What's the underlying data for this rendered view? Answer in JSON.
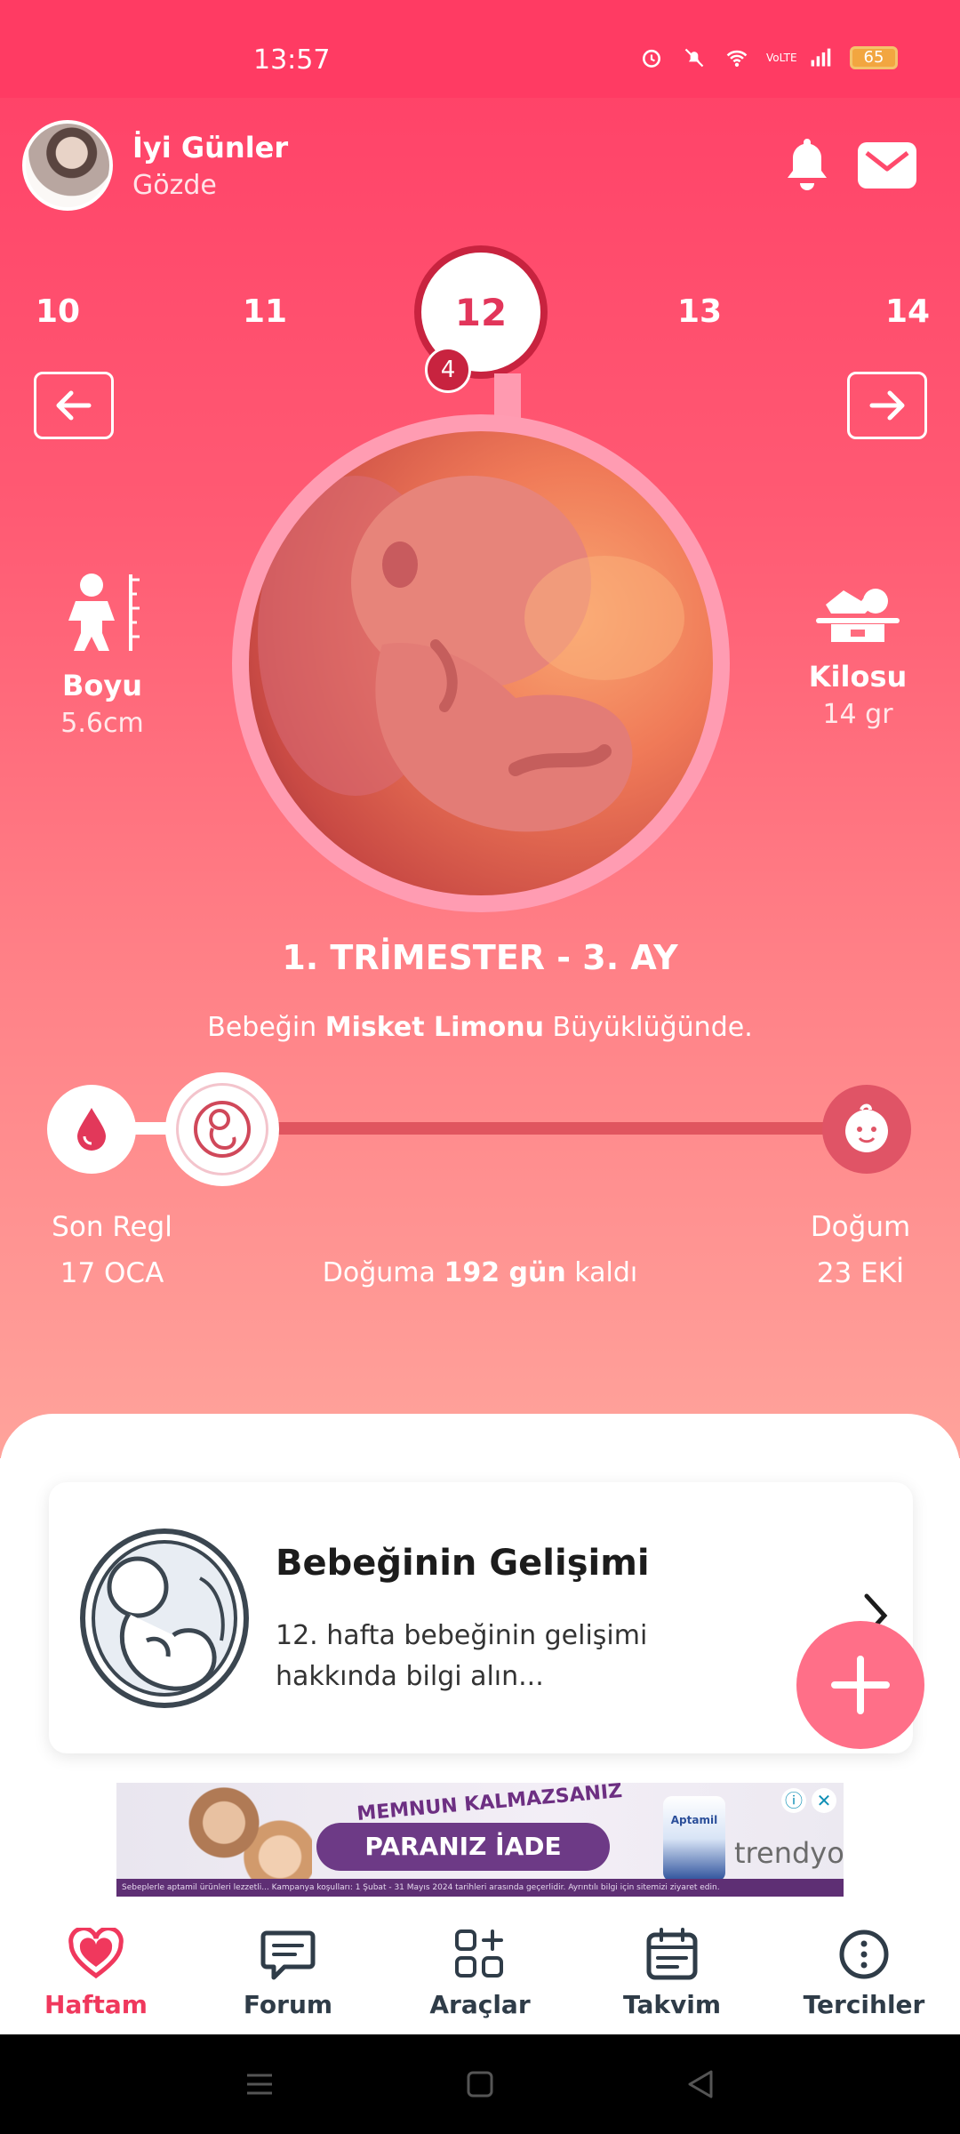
{
  "status_bar": {
    "time": "13:57",
    "network": "VoLTE",
    "battery": "65"
  },
  "header": {
    "greeting": "İyi Günler",
    "user_name": "Gözde"
  },
  "weeks": {
    "items": [
      "10",
      "11",
      "12",
      "13",
      "14"
    ],
    "current": "12",
    "badge": "4"
  },
  "metrics": {
    "length_title": "Boyu",
    "length_value": "5.6cm",
    "weight_title": "Kilosu",
    "weight_value": "14 gr"
  },
  "trimester": "1. TRİMESTER - 3. AY",
  "size_text": {
    "before": "Bebeğin ",
    "fruit": "Misket Limonu",
    "after": " Büyüklüğünde."
  },
  "timeline": {
    "progress": 0.17,
    "start_label": "Son Regl",
    "start_date": "17 OCA",
    "end_label": "Doğum",
    "end_date": "23 EKİ",
    "countdown_before": "Doğuma ",
    "countdown_value": "192 gün",
    "countdown_after": " kaldı"
  },
  "card": {
    "title": "Bebeğinin Gelişimi",
    "text": "12. hafta bebeğinin gelişimi hakkında bilgi alın..."
  },
  "ad": {
    "headline": "MEMNUN KALMAZSANIZ",
    "cta": "PARANIZ İADE",
    "brand": "trendyol",
    "product": "Aptamil",
    "fine_print": "Sebeplerle aptamil ürünleri lezzetli... Kampanya koşulları: 1 Şubat - 31 Mayıs 2024 tarihleri arasında geçerlidir. Ayrıntılı bilgi için sitemizi ziyaret edin."
  },
  "bottom_nav": [
    {
      "label": "Haftam",
      "icon": "heart-icon",
      "active": true
    },
    {
      "label": "Forum",
      "icon": "chat-icon",
      "active": false
    },
    {
      "label": "Araçlar",
      "icon": "grid-plus-icon",
      "active": false
    },
    {
      "label": "Takvim",
      "icon": "calendar-icon",
      "active": false
    },
    {
      "label": "Tercihler",
      "icon": "more-icon",
      "active": false
    }
  ],
  "colors": {
    "accent": "#f0385d",
    "hero_top": "#ff3e66",
    "hero_bottom": "#ffa39b",
    "dark_red": "#c8233f",
    "fab": "#ff6f88"
  }
}
